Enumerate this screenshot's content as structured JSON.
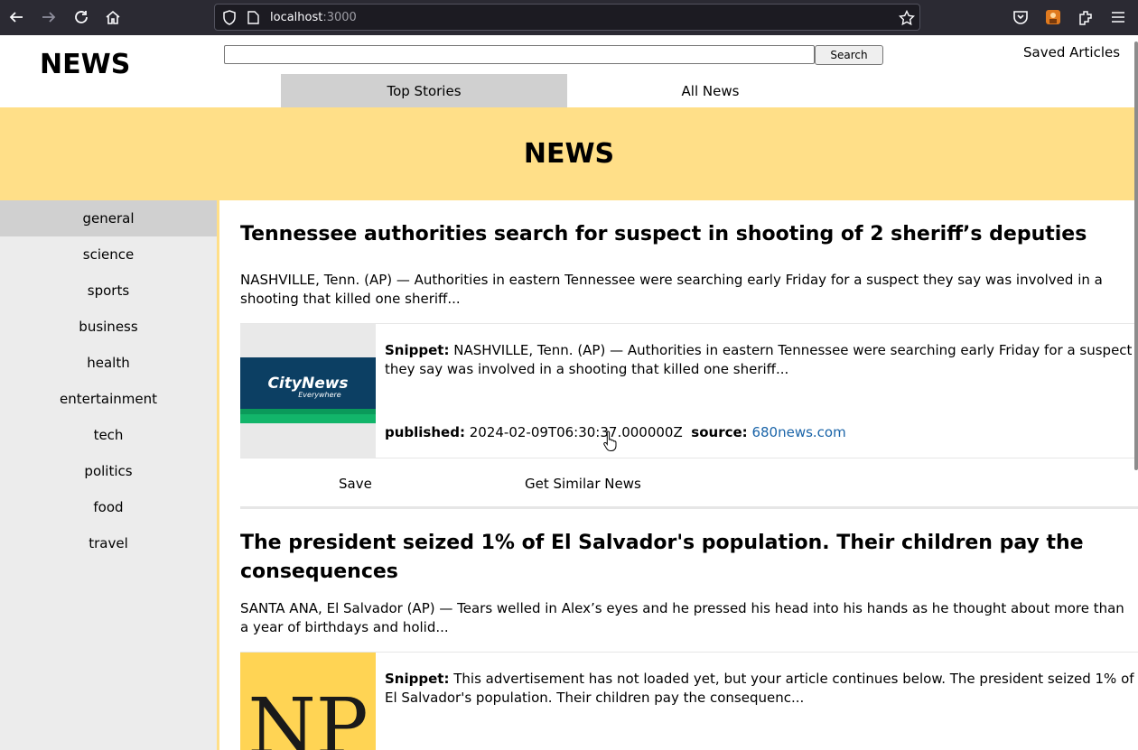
{
  "browser": {
    "url_host": "localhost",
    "url_port": ":3000"
  },
  "header": {
    "logo": "NEWS",
    "search_value": "",
    "search_label": "Search",
    "saved_label": "Saved Articles",
    "tabs": [
      {
        "label": "Top Stories",
        "active": true
      },
      {
        "label": "All News",
        "active": false
      }
    ]
  },
  "banner": {
    "title": "NEWS"
  },
  "sidebar": {
    "categories": [
      {
        "label": "general",
        "active": true
      },
      {
        "label": "science"
      },
      {
        "label": "sports"
      },
      {
        "label": "business"
      },
      {
        "label": "health"
      },
      {
        "label": "entertainment"
      },
      {
        "label": "tech"
      },
      {
        "label": "politics"
      },
      {
        "label": "food"
      },
      {
        "label": "travel"
      }
    ]
  },
  "articles": [
    {
      "title": "Tennessee authorities search for suspect in shooting of 2 sheriff’s deputies",
      "description": "NASHVILLE, Tenn. (AP) — Authorities in eastern Tennessee were searching early Friday for a suspect they say was involved in a shooting that killed one sheriff...",
      "snippet_label": "Snippet:",
      "snippet": "NASHVILLE, Tenn. (AP) — Authorities in eastern Tennessee were searching early Friday for a suspect they say was involved in a shooting that killed one sheriff...",
      "published_label": "published:",
      "published": "2024-02-09T06:30:37.000000Z",
      "source_label": "source:",
      "source": "680news.com",
      "image_text_1": "CityNews",
      "image_text_2": "Everywhere",
      "save_label": "Save",
      "similar_label": "Get Similar News"
    },
    {
      "title": "The president seized 1% of El Salvador's population. Their children pay the consequences",
      "description": "SANTA ANA, El Salvador (AP) — Tears welled in Alex’s eyes and he pressed his head into his hands as he thought about more than a year of birthdays and holid...",
      "snippet_label": "Snippet:",
      "snippet": "This advertisement has not loaded yet, but your article continues below. The president seized 1% of El Salvador's population. Their children pay the consequenc...",
      "image_text_1": "NP"
    }
  ]
}
